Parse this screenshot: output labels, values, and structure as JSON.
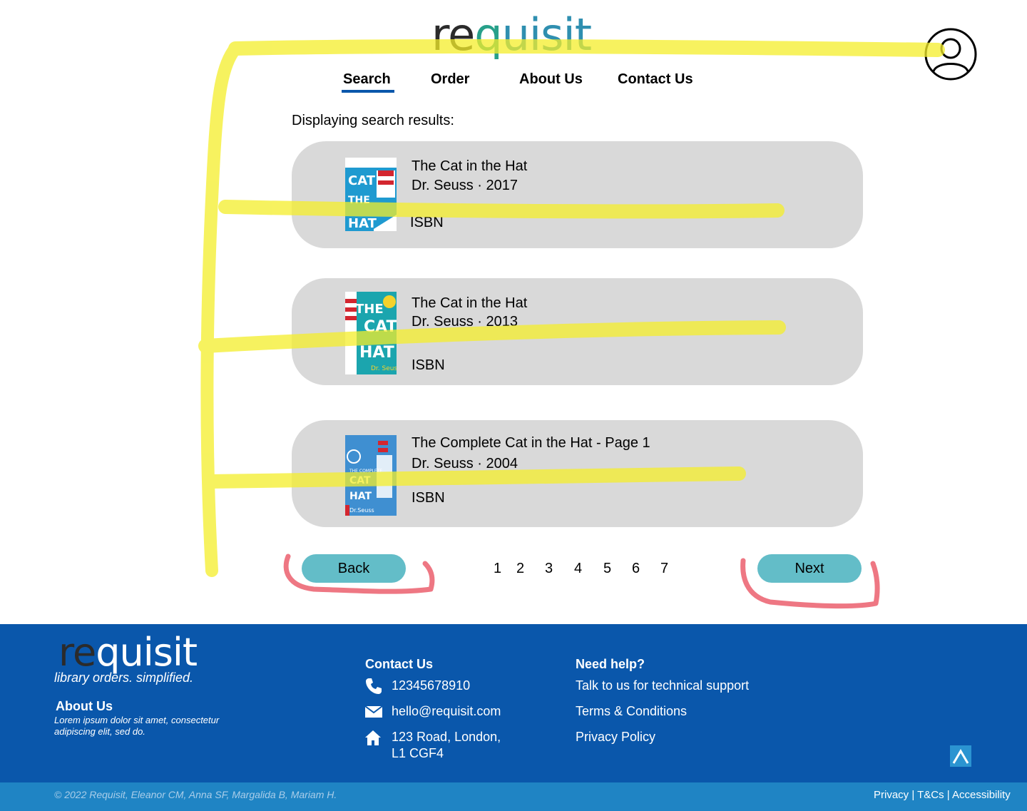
{
  "header": {
    "logo": {
      "re": "re",
      "q": "q",
      "rest": "uisit"
    },
    "nav": [
      {
        "label": "Search",
        "active": true
      },
      {
        "label": "Order"
      },
      {
        "label": "About Us"
      },
      {
        "label": "Contact Us"
      }
    ],
    "account_icon": "user-circle-icon"
  },
  "results": {
    "heading": "Displaying search results:",
    "items": [
      {
        "title": "The Cat in the Hat",
        "meta": "Dr. Seuss · 2017",
        "isbn": "ISBN"
      },
      {
        "title": "The Cat in the Hat",
        "meta": "Dr. Seuss · 2013",
        "isbn": "ISBN"
      },
      {
        "title": "The Complete Cat in the Hat - Page 1",
        "meta": "Dr. Seuss · 2004",
        "isbn": "ISBN"
      }
    ]
  },
  "pagination": {
    "back_label": "Back",
    "next_label": "Next",
    "pages": [
      "1",
      "2",
      "3",
      "4",
      "5",
      "6",
      "7"
    ]
  },
  "footer": {
    "logo": {
      "re": "re",
      "q": "q",
      "rest": "uisit"
    },
    "tagline": "library orders. simplified.",
    "about_heading": "About Us",
    "about_text": "Lorem ipsum dolor sit amet, consectetur adipiscing elit, sed do.",
    "contact_heading": "Contact Us",
    "phone": "12345678910",
    "email": "hello@requisit.com",
    "address_line1": "123 Road, London,",
    "address_line2": "L1 CGF4",
    "help_heading": "Need help?",
    "help_links": [
      "Talk to us for technical support",
      "Terms & Conditions",
      "Privacy Policy"
    ],
    "copyright": "© 2022 Requisit, Eleanor CM, Anna SF, Margalida B, Mariam H.",
    "legal": "Privacy |  T&Cs | Accessibility"
  },
  "colors": {
    "brand_blue": "#0a57ab",
    "accent_teal": "#63bdc8",
    "card_grey": "#d9d9d9",
    "highlighter_yellow": "#f4ee2a",
    "marker_red": "#e8495a"
  }
}
